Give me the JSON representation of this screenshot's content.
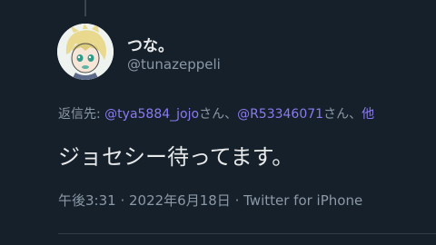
{
  "author": {
    "display_name": "つな。",
    "handle": "@tunazeppeli",
    "avatar_icon": "anime-character-avatar-icon"
  },
  "reply": {
    "prefix": "返信先: ",
    "mention_1": "@tya5884_jojo",
    "suffix_1": "さん、",
    "mention_2": "@R53346071",
    "suffix_2": "さん、",
    "overflow": "他"
  },
  "tweet": {
    "text": "ジョセシー待ってます。"
  },
  "meta": {
    "time": "午後3:31",
    "sep_1": " · ",
    "date": "2022年6月18日",
    "sep_2": " · ",
    "source": "Twitter for iPhone"
  },
  "colors": {
    "background": "#15202b",
    "link": "#8c7af0",
    "secondary_text": "#8b98a5",
    "primary_text": "#e7e9ea"
  }
}
